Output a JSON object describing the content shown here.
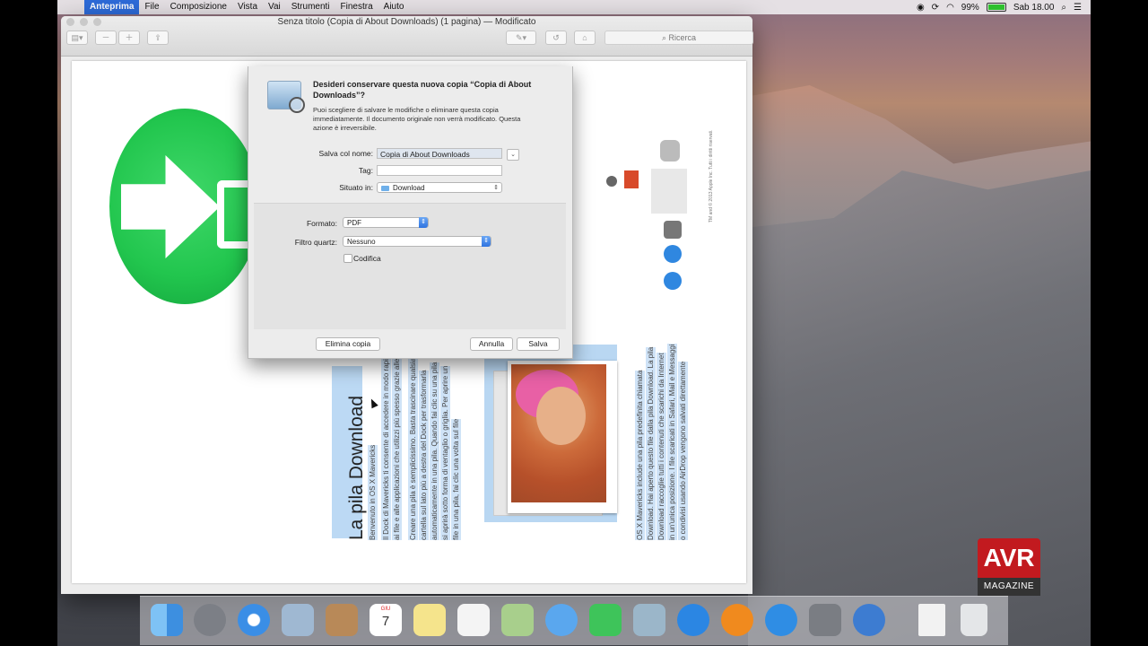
{
  "menubar": {
    "app": "Anteprima",
    "menus": [
      "File",
      "Composizione",
      "Vista",
      "Vai",
      "Strumenti",
      "Finestra",
      "Aiuto"
    ],
    "battery": "99%",
    "battery_level": 0.99,
    "clock": "Sab 18.00"
  },
  "window": {
    "title": "Senza titolo (Copia di About Downloads) (1 pagina) — Modificato",
    "search_placeholder": "Ricerca"
  },
  "dialog": {
    "question": "Desideri conservare questa nuova copia “Copia di About Downloads”?",
    "info": "Puoi scegliere di salvare le modifiche o eliminare questa copia immediatamente. Il documento originale non verrà modificato. Questa azione è irreversibile.",
    "save_as_label": "Salva col nome:",
    "save_as_value": "Copia di About Downloads",
    "tag_label": "Tag:",
    "tag_value": "",
    "where_label": "Situato in:",
    "where_value": "Download",
    "format_label": "Formato:",
    "format_value": "PDF",
    "quartz_label": "Filtro quartz:",
    "quartz_value": "Nessuno",
    "encrypt_label": "Codifica",
    "encrypt_checked": false,
    "delete_button": "Elimina copia",
    "cancel_button": "Annulla",
    "save_button": "Salva"
  },
  "document": {
    "heading": "La pila Download",
    "col1": [
      "Benvenuto in OS X Mavericks"
    ],
    "col2": [
      "Il Dock di Mavericks ti consente di accedere in modo rapi",
      "ai file e alle applicazioni che utilizzi più spesso grazie alle"
    ],
    "col3": [
      "Creare una pila è semplicissimo. Basta trascinare qualsia",
      "cartella sul lato più a destra del Dock per trasformarla",
      "automaticamente in una pila. Quando fai clic su una pila",
      "si aprirà sotto forma di ventaglio o griglia. Per aprire un",
      "file in una pila, fai clic una volta sul file"
    ],
    "col4": [
      "OS X Mavericks include una pila predefinita chiamata",
      "Download. Hai aperto questo file dalla pila Download. La pila",
      "Download raccoglie tutti i contenuti che scarichi da Internet",
      "in un'unica posizione. I file scaricati in Safari, Mail e Messaggi",
      "o condivisi usando AirDrop vengono salvati direttamente"
    ],
    "copyright": "TM and © 2013 Apple Inc. Tutti i diritti riservati."
  },
  "dock": {
    "calendar_month": "GIU",
    "calendar_day": "7",
    "items": [
      "finder-icon",
      "launchpad-icon",
      "safari-icon",
      "mail-icon",
      "contacts-icon",
      "calendar-icon",
      "notes-icon",
      "reminders-icon",
      "maps-icon",
      "messages-icon",
      "facetime-icon",
      "preview-icon",
      "itunes-icon",
      "ibooks-icon",
      "appstore-icon",
      "system-preferences-icon",
      "quicktime-icon",
      "document-icon",
      "trash-icon"
    ]
  },
  "watermark": {
    "line1": "AVR",
    "line2": "MAGAZINE"
  },
  "colors": {
    "menu_highlight": "#2d6bd9",
    "accent": "#2e73e0",
    "brand_red": "#c21a1f"
  }
}
